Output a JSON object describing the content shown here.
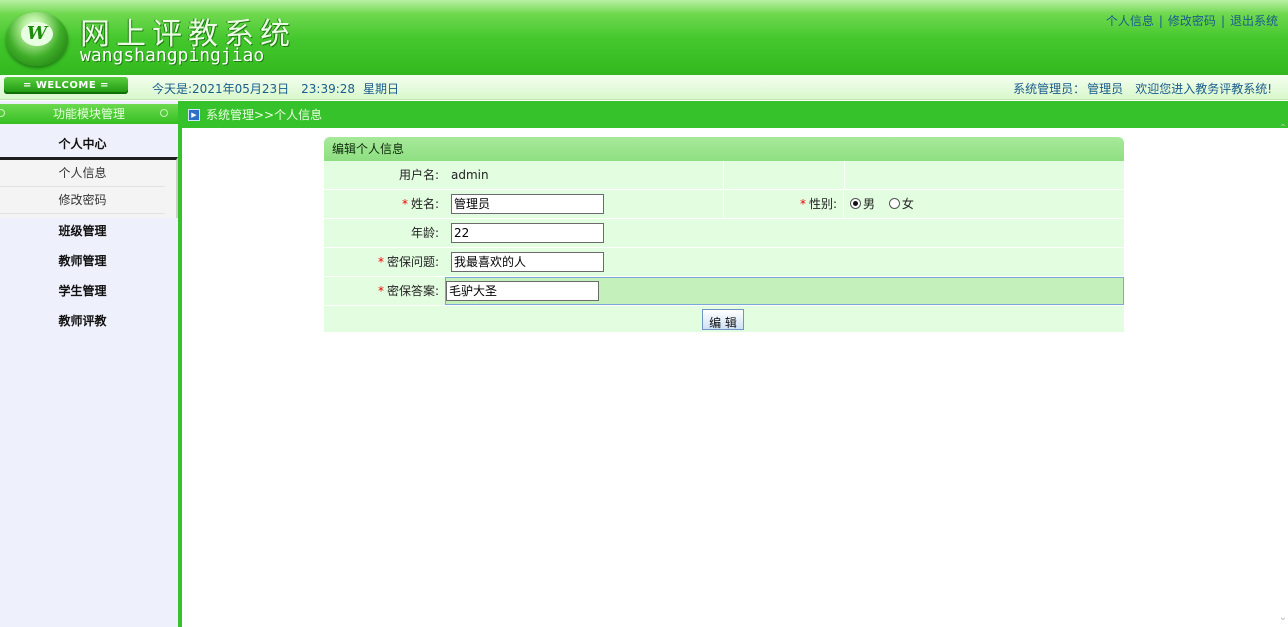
{
  "header": {
    "logo_letter": "W",
    "title_cn": "网上评教系统",
    "title_en": "wangshangpingjiao",
    "links": [
      "个人信息",
      "修改密码",
      "退出系统"
    ],
    "separator": "|"
  },
  "infobar": {
    "welcome": "= WELCOME =",
    "today_label": "今天是:",
    "date": "2021年05月23日",
    "time": "23:39:28",
    "weekday": "星期日",
    "role": "系统管理员：",
    "username": "管理员",
    "welcome_msg": "欢迎您进入教务评教系统!"
  },
  "sidebar": {
    "title": "功能模块管理",
    "groups": [
      {
        "label": "个人中心",
        "items": [
          "个人信息",
          "修改密码"
        ]
      },
      {
        "label": "班级管理"
      },
      {
        "label": "教师管理"
      },
      {
        "label": "学生管理"
      },
      {
        "label": "教师评教"
      }
    ]
  },
  "breadcrumb": "系统管理>>个人信息",
  "form": {
    "title": "编辑个人信息",
    "required_mark": "*",
    "username_label": "用户名:",
    "username_value": "admin",
    "name_label": "姓名:",
    "name_value": "管理员",
    "gender_label": "性别:",
    "gender_options": [
      "男",
      "女"
    ],
    "gender_selected": "男",
    "age_label": "年龄:",
    "age_value": "22",
    "question_label": "密保问题:",
    "question_value": "我最喜欢的人",
    "answer_label": "密保答案:",
    "answer_value": "毛驴大圣",
    "submit_label": "编 辑"
  },
  "colors": {
    "brand_green": "#36c22a",
    "link_blue": "#1a5c8c",
    "form_row_bg": "#e3fde0",
    "required": "#e00000"
  },
  "icons": [
    "logo-icon",
    "breadcrumb-arrow-icon",
    "scroll-up-icon",
    "scroll-down-icon"
  ]
}
